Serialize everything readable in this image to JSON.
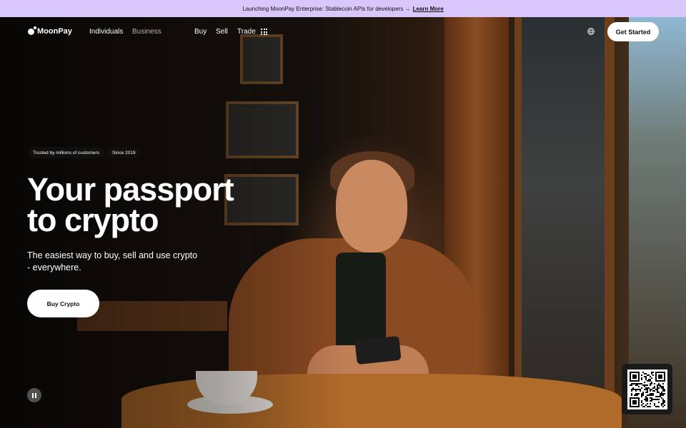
{
  "banner": {
    "text": "Launching MoonPay Enterprise: Stablecoin APIs for developers →",
    "link": "Learn More"
  },
  "nav": {
    "logo": "MoonPay",
    "individuals": "Individuals",
    "business": "Business",
    "buy": "Buy",
    "sell": "Sell",
    "trade": "Trade",
    "cta": "Get Started"
  },
  "hero": {
    "badge_1": "Trusted by millions of customers",
    "badge_2": "Since 2019",
    "headline_1": "Your passport",
    "headline_2": "to crypto",
    "subhead": "The easiest way to buy, sell and use crypto - everywhere.",
    "button": "Buy Crypto"
  },
  "icons": {
    "grid": "grid-icon",
    "globe": "globe-icon",
    "pause": "pause-icon",
    "qr": "qr-code"
  },
  "colors": {
    "banner": "#d9c7fb",
    "button": "#ffffff"
  }
}
